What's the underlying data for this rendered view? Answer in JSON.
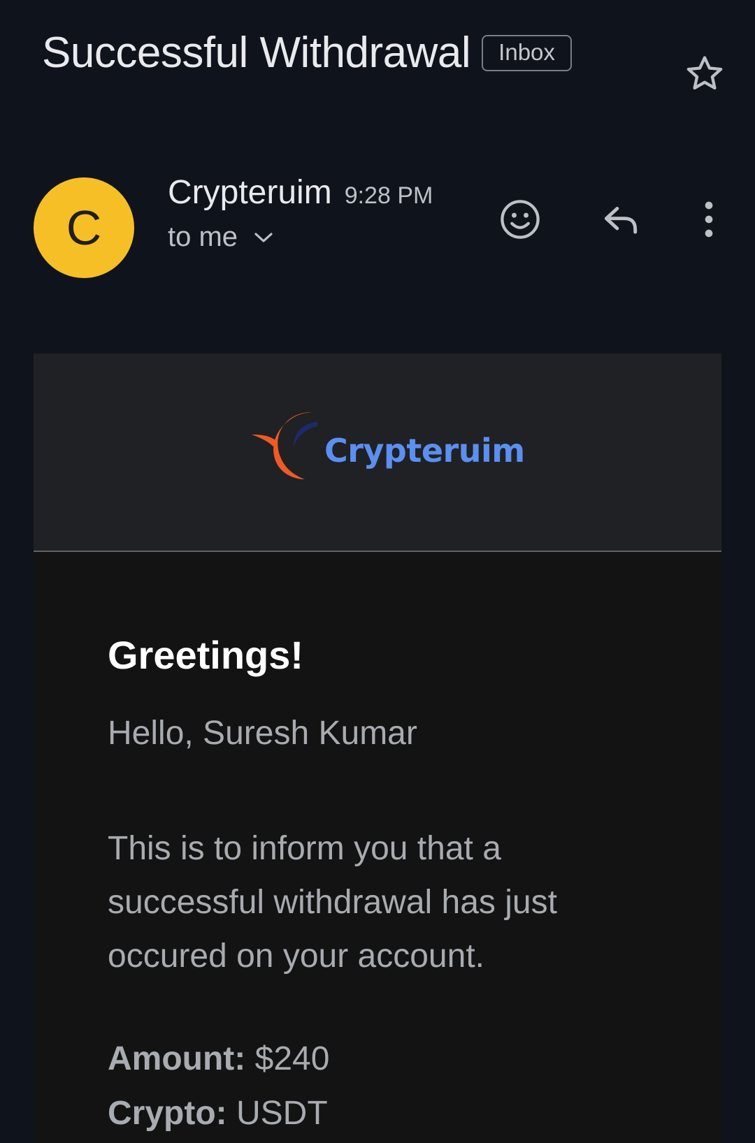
{
  "email": {
    "subject": "Successful Withdrawal",
    "label": "Inbox",
    "sender": {
      "avatar_letter": "C",
      "avatar_color": "#f6bf26",
      "name": "Crypteruim",
      "time": "9:28 PM",
      "recipient": "to me"
    },
    "actions": {
      "star_icon": "star-outline",
      "emoji_icon": "emoji-smile",
      "reply_icon": "reply-arrow",
      "more_icon": "more-vertical"
    },
    "body": {
      "logo_text": "Crypteruim",
      "greeting": "Greetings!",
      "hello": "Hello, Suresh Kumar",
      "message": "This is to inform you that a successful withdrawal has just occured on your account.",
      "details": [
        {
          "label": "Amount:",
          "value": "$240"
        },
        {
          "label": "Crypto:",
          "value": "USDT"
        }
      ]
    }
  },
  "colors": {
    "background": "#0f141c",
    "card": "#131313",
    "logo_band": "#202124",
    "logo_blue": "#5b8ff0",
    "logo_orange": "#f05a24"
  }
}
